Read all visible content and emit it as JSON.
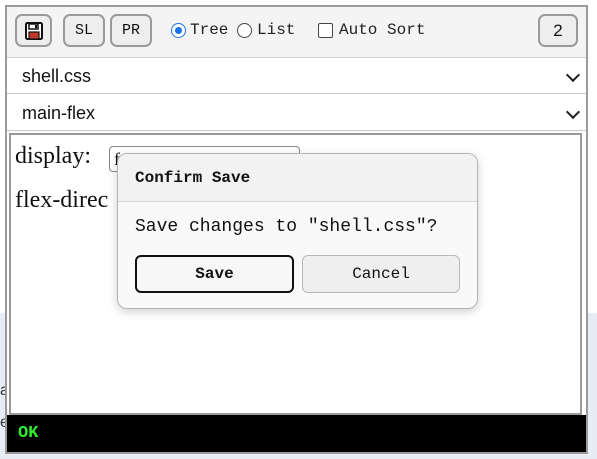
{
  "toolbar": {
    "save_icon": "floppy-disk-icon",
    "sl_label": "SL",
    "pr_label": "PR",
    "view_options": [
      {
        "label": "Tree",
        "selected": true
      },
      {
        "label": "List",
        "selected": false
      }
    ],
    "auto_sort": {
      "label": "Auto Sort",
      "checked": false
    },
    "count_label": "2"
  },
  "file_select": {
    "value": "shell.css"
  },
  "rule_select": {
    "value": "main-flex"
  },
  "editor": {
    "properties": [
      {
        "name": "display:",
        "value": "f"
      },
      {
        "name": "flex-direc",
        "value": ""
      }
    ]
  },
  "status": {
    "text": "OK",
    "color": "#2ef02e"
  },
  "dialog": {
    "title": "Confirm Save",
    "message": "Save changes to \"shell.css\"?",
    "confirm_label": "Save",
    "cancel_label": "Cancel"
  },
  "background": {
    "letters": [
      "a",
      "e"
    ]
  },
  "colors": {
    "accent": "#1a73e8",
    "status_bg": "#000000"
  }
}
